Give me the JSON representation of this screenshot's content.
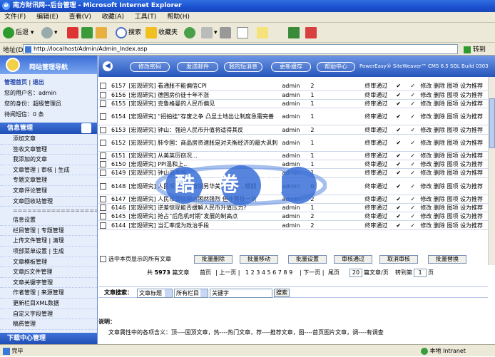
{
  "window": {
    "title": "南方财讯网--后台管理 - Microsoft Internet Explorer"
  },
  "menu": [
    "文件(F)",
    "编辑(E)",
    "查看(V)",
    "收藏(A)",
    "工具(T)",
    "帮助(H)"
  ],
  "toolbar": {
    "back": "后退",
    "search": "搜索",
    "favorites": "收藏夹"
  },
  "address": {
    "label": "地址(D)",
    "url": "http://localhost/Admin/Admin_Index.asp",
    "go": "转到"
  },
  "sidebar": {
    "title": "网站管理导航",
    "home": "管理首页",
    "logout": "退出",
    "username_label": "您的用户名：",
    "username": "admin",
    "identity_label": "您的身份：",
    "identity": "超级管理员",
    "pending_label": "待阅短信：",
    "pending": "0 条",
    "section1": "信息管理",
    "items": [
      "添加文章",
      "签收文章管理",
      "我添加的文章",
      "文章管理 | 审核 | 生成",
      "专题文章管理",
      "文章评论管理",
      "文章回收站管理"
    ],
    "separator": "==================",
    "items2": [
      "信息设置",
      "栏目管理 | 专题管理",
      "上传文件管理 | 清理",
      "项部菜单设置 | 生成",
      "文章模板管理",
      "文章JS文件管理",
      "文章关键字管理",
      "作者管理 | 来源管理",
      "更新栏目XML数据",
      "自定义字段管理",
      "稿费管理"
    ],
    "section2": "下载中心管理"
  },
  "topnav": {
    "buttons": [
      "修改密码",
      "发送邮件",
      "我的短消息",
      "更新缓存",
      "帮助中心"
    ],
    "powered": "PowerEasy® SiteWeaver™ CMS 6.5 SQL Build 0303"
  },
  "articles": [
    {
      "id": "6157",
      "title": "[宏观研究] 看通胀不能偏信CPI",
      "author": "admin",
      "hits": "2",
      "status": "终审通过",
      "ops": "修改 删除 图项 设为推荐"
    },
    {
      "id": "6156",
      "title": "[宏观研究] 德国房价徒十年不涨",
      "author": "admin",
      "hits": "1",
      "status": "终审通过",
      "ops": "修改 删除 图项 设为推荐"
    },
    {
      "id": "6155",
      "title": "[宏观研究] 克鲁格曼的人民币偏见",
      "author": "admin",
      "hits": "1",
      "status": "终审通过",
      "ops": "修改 删除 图项 设为推荐"
    },
    {
      "id": "6154",
      "title": "[宏观研究] “招拍挂”存废之争 凸显土地出让制度急需完善",
      "author": "admin",
      "hits": "1",
      "status": "终审通过",
      "ops": "修改 删除 图项 设为推荐",
      "tall": true
    },
    {
      "id": "6153",
      "title": "[宏观研究] 钟山：强迫人民币升值将适得其反",
      "author": "admin",
      "hits": "2",
      "status": "终审通过",
      "ops": "修改 删除 图项 设为推荐"
    },
    {
      "id": "6152",
      "title": "[宏观研究] 肺令国：商品房资速胀是对夫衡经济的最大讽刺",
      "author": "admin",
      "hits": "1",
      "status": "终审通过",
      "ops": "修改 删除 图项 设为推荐",
      "tall": true
    },
    {
      "id": "6151",
      "title": "[宏观研究] 从美英历窃况...",
      "author": "admin",
      "hits": "1",
      "status": "终审通过",
      "ops": "修改 删除 图项 设为推荐"
    },
    {
      "id": "6150",
      "title": "[宏观研究] PPI温和上..",
      "author": "admin",
      "hits": "1",
      "status": "终审通过",
      "ops": "修改 删除 图项 设为推荐"
    },
    {
      "id": "6149",
      "title": "[宏观研究] 钟山谈美国...",
      "author": "admin",
      "hits": "1",
      "status": "终审通过",
      "ops": "修改 删除 图项 设为推荐"
    },
    {
      "id": "6148",
      "title": "[宏观研究] 人民币短期升值期另华美 以及币...暖期",
      "author": "admin",
      "hits": "0",
      "status": "终审通过",
      "ops": "修改 删除 图项 设为推荐",
      "tall": true
    },
    {
      "id": "6147",
      "title": "[宏观研究] 人民币重估理由困然强烈 但非赛极一块",
      "author": "admin",
      "hits": "2",
      "status": "终审通过",
      "ops": "修改 删除 图项 设为推荐"
    },
    {
      "id": "6146",
      "title": "[宏观研究] 逆差惊现能否缓解人民币升值压力?",
      "author": "admin",
      "hits": "1",
      "status": "终审通过",
      "ops": "修改 删除 图项 设为推荐"
    },
    {
      "id": "6145",
      "title": "[宏观研究] 抢占“后危机时期”发展的制高点",
      "author": "admin",
      "hits": "2",
      "status": "终审通过",
      "ops": "修改 删除 图项 设为推荐"
    },
    {
      "id": "6144",
      "title": "[宏观研究] 当汇率成为政治手段",
      "author": "admin",
      "hits": "2",
      "status": "终审通过",
      "ops": "修改 删除 图项 设为推荐"
    }
  ],
  "actions": {
    "select_all": "选中本页显示的所有文章",
    "buttons": [
      "批量删除",
      "批量移动",
      "批量设置",
      "审核通过",
      "取消审核",
      "批量替换"
    ]
  },
  "pager": {
    "text1": "共",
    "total": "5973",
    "text2": "篇文章",
    "first": "首页",
    "prev": "上一页",
    "pages": "1 2 3 4 5 6 7 8 9",
    "next": "下一页",
    "last": "尾页",
    "per_page": "20",
    "per_label": "篇文章/页",
    "goto": "转到第",
    "page": "1",
    "page_suffix": "页"
  },
  "search": {
    "label": "文章搜索：",
    "field": "文章标题",
    "column": "所有栏目",
    "keyword": "关键字",
    "button": "搜索"
  },
  "notes": {
    "title": "说明：",
    "text": "文章属性中的各项含义：顶----固顶文章，热----热门文章，荐----推荐文章，图----首页图片文章，调----有调查"
  },
  "status": {
    "left": "完毕",
    "right": "本地 Intranet"
  },
  "watermark": "酷卷网",
  "colors": {
    "accent": "#2555bb",
    "sidebar_bg": "#e6eefc"
  }
}
